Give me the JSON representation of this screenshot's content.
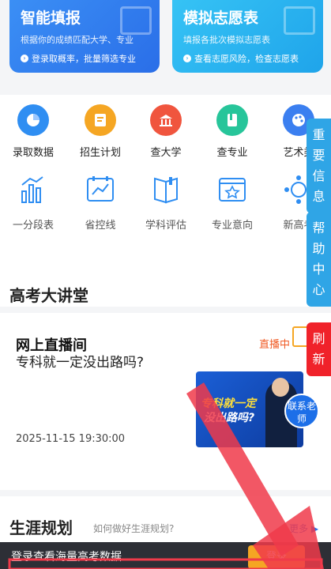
{
  "cards": {
    "left": {
      "title": "智能填报",
      "desc": "根据你的成绩匹配大学、专业",
      "link": "登录取概率，批量筛选专业"
    },
    "right": {
      "title": "模拟志愿表",
      "desc": "填报各批次模拟志愿表",
      "link": "查看志愿风险，检查志愿表"
    }
  },
  "grid_row1": [
    {
      "label": "录取数据",
      "color": "#2f8ef2",
      "icon": "pie-chart-icon"
    },
    {
      "label": "招生计划",
      "color": "#f5a623",
      "icon": "document-icon"
    },
    {
      "label": "查大学",
      "color": "#f0553e",
      "icon": "university-icon"
    },
    {
      "label": "查专业",
      "color": "#27c59a",
      "icon": "book-icon"
    },
    {
      "label": "艺术类",
      "color": "#3b7ff0",
      "icon": "palette-icon"
    }
  ],
  "grid_row2": [
    {
      "label": "一分段表",
      "icon": "bar-chart-icon"
    },
    {
      "label": "省控线",
      "icon": "line-chart-icon"
    },
    {
      "label": "学科评估",
      "icon": "open-book-icon"
    },
    {
      "label": "专业意向",
      "icon": "star-window-icon"
    },
    {
      "label": "新高考",
      "icon": "network-icon"
    }
  ],
  "side": {
    "important": "重要信息",
    "help": "帮助中心",
    "refresh": "刷新"
  },
  "lecture": {
    "section_title": "高考大讲堂",
    "live_title": "网上直播间",
    "live_status": "直播中",
    "question": "专科就一定没出路吗?",
    "time": "2025-11-15 19:30:00",
    "banner_line1": "专科就一定",
    "banner_line2": "没出路吗?",
    "contact": "联系老师"
  },
  "career": {
    "title": "生涯规划",
    "subtitle": "如何做好生涯规划?",
    "more": "更多"
  },
  "login_bar": {
    "text": "登录查看海量高考数据",
    "button": "登录"
  },
  "colors": {
    "accent": "#2a6ee8",
    "live": "#f05a24",
    "arrow": "#f03a4a"
  }
}
